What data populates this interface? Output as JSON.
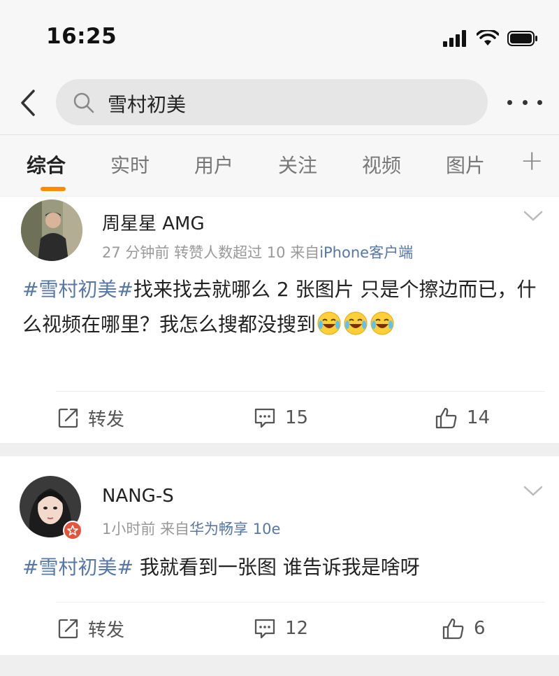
{
  "status": {
    "time": "16:25"
  },
  "search": {
    "query": "雪村初美"
  },
  "tabs": [
    "综合",
    "实时",
    "用户",
    "关注",
    "视频",
    "图片"
  ],
  "tab_plus": "+",
  "posts": [
    {
      "username": "周星星 AMG",
      "meta_time": "27 分钟前",
      "meta_reposts": "转赞人数超过 10",
      "meta_from": "来自",
      "meta_source": "iPhone客户端",
      "topic": "#雪村初美#",
      "text": "找来找去就哪么 2 张图片 只是个擦边而已，什么视频在哪里？我怎么搜都没搜到",
      "emoji": [
        "laughing-crying",
        "laughing-crying",
        "laughing-crying"
      ],
      "repost_label": "转发",
      "comment_count": "15",
      "like_count": "14"
    },
    {
      "username": "NANG-S",
      "meta_time": "1小时前",
      "meta_from": "来自",
      "meta_source": "华为畅享 10e",
      "topic": "#雪村初美#",
      "text": " 我就看到一张图 谁告诉我是啥呀",
      "repost_label": "转发",
      "comment_count": "12",
      "like_count": "6"
    }
  ],
  "colors": {
    "accent": "#ff8a00",
    "link": "#5677a8",
    "badge": "#e5533b"
  }
}
